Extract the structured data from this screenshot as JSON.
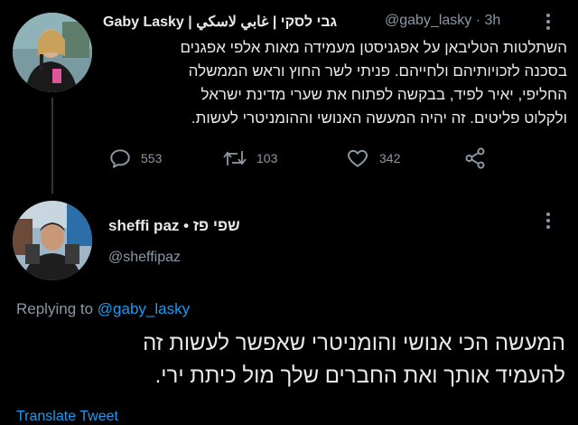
{
  "tweet": {
    "display_name": "Gaby Lasky | גבי לסקי | غابي لاسكي",
    "handle": "@gaby_lasky",
    "separator": "·",
    "time": "3h",
    "more_icon": "more-dots-icon",
    "text_lines": [
      "השתלטות הטליבאן על אפגניסטן מעמידה מאות אלפי אפגנים",
      "בסכנה לזכויותיהם ולחייהם. פניתי לשר החוץ וראש הממשלה",
      "החליפי, יאיר לפיד, בבקשה לפתוח את שערי מדינת ישראל",
      "ולקלוט פליטים. זה יהיה המעשה האנושי וההומניטרי לעשות."
    ],
    "actions": {
      "replies": "553",
      "retweets": "103",
      "likes": "342"
    }
  },
  "reply": {
    "display_name": "sheffi paz • שפי פז",
    "handle": "@sheffipaz",
    "replying_prefix": "Replying to",
    "replying_handle": "@gaby_lasky",
    "text_lines": [
      "המעשה הכי אנושי והומניטרי שאפשר לעשות זה",
      "להעמיד אותך ואת החברים שלך מול כיתת ירי."
    ],
    "translate": "Translate Tweet"
  },
  "colors": {
    "background": "#000000",
    "text": "#e7e9ea",
    "muted": "#8b98a5",
    "link": "#1d9bf0"
  }
}
